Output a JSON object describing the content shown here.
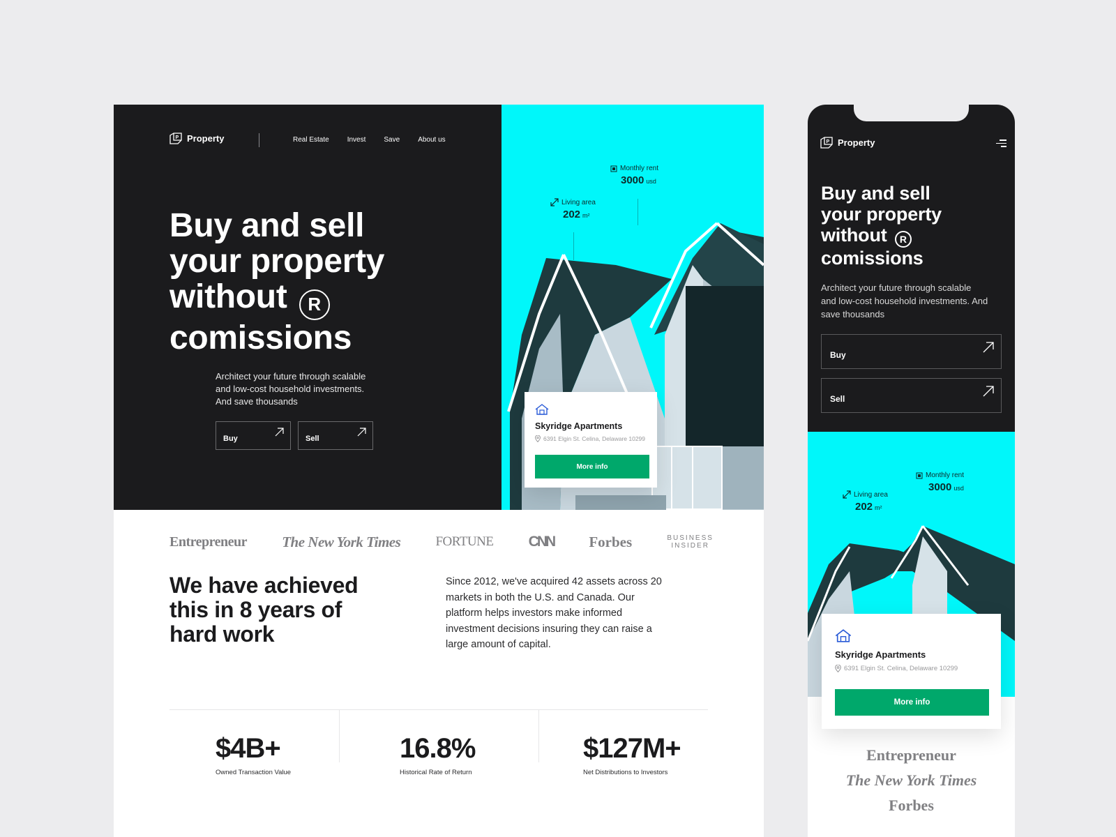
{
  "brand": {
    "name": "Property"
  },
  "nav": {
    "items": [
      "Real Estate",
      "Invest",
      "Save",
      "About us"
    ]
  },
  "hero": {
    "title_lines": [
      "Buy and sell",
      "your property",
      "without",
      "comissions"
    ],
    "reg_symbol": "R",
    "subtitle": "Architect your future through scalable and low-cost household investments. And save thousands",
    "buy_label": "Buy",
    "sell_label": "Sell"
  },
  "property": {
    "monthly_rent_label": "Monthly rent",
    "monthly_rent_value": "3000",
    "monthly_rent_unit": "usd",
    "living_area_label": "Living area",
    "living_area_value": "202",
    "living_area_unit": "m²",
    "name": "Skyridge Apartments",
    "address": "6391 Elgin St. Celina, Delaware 10299",
    "more_info_label": "More info"
  },
  "press": {
    "entrepreneur": "Entrepreneur",
    "nyt": "The New York Times",
    "fortune": "FORTUNE",
    "cnn": "CNN",
    "forbes": "Forbes",
    "bi_line1": "BUSINESS",
    "bi_line2": "INSIDER"
  },
  "about": {
    "heading": "We have achieved this in 8 years of hard work",
    "body": "Since 2012, we've acquired 42 assets across 20 markets in both the U.S. and Canada. Our platform helps investors make informed investment decisions insuring they can raise a large amount of capital."
  },
  "metrics": [
    {
      "value": "$4B+",
      "caption": "Owned Transaction Value"
    },
    {
      "value": "16.8%",
      "caption": "Historical Rate of Return"
    },
    {
      "value": "$127M+",
      "caption": "Net Distributions to Investors"
    }
  ],
  "colors": {
    "dark": "#1b1b1d",
    "cyan": "#00f7fa",
    "green": "#00a86b",
    "page_bg": "#ececee"
  },
  "icons": [
    "property-logo-icon",
    "arrow-up-right-icon",
    "menu-icon",
    "home-icon",
    "location-pin-icon",
    "resize-icon",
    "rent-icon"
  ]
}
